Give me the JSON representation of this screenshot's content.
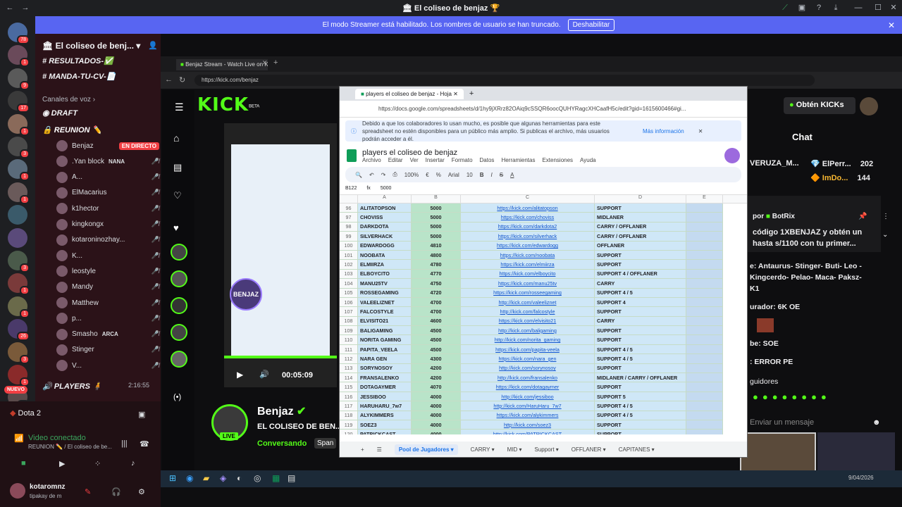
{
  "window": {
    "title": "El coliseo de benjaz"
  },
  "banner": {
    "text": "El modo Streamer está habilitado. Los nombres de usuario se han truncado.",
    "button": "Deshabilitar"
  },
  "guild_badges": [
    "78",
    "1",
    "9",
    "17",
    "1",
    "3",
    "1",
    "1",
    "",
    "",
    "3",
    "1",
    "1",
    "26",
    "3",
    "1",
    "16",
    "18",
    "3"
  ],
  "server": {
    "name": "El coliseo de benj...",
    "channels": [
      "RESULTADOS-✅",
      "MANDA-TU-CV-📄"
    ],
    "voice_category": "Canales de voz",
    "voice": [
      "DRAFT",
      "REUNION ✏️"
    ],
    "users": [
      {
        "name": "Benjaz",
        "live": "EN DIRECTO"
      },
      {
        "name": ".Yan block",
        "tag": "NANA"
      },
      {
        "name": "A..."
      },
      {
        "name": "ElMacarius"
      },
      {
        "name": "k1hector"
      },
      {
        "name": "kingkongx"
      },
      {
        "name": "kotaroninozhay..."
      },
      {
        "name": "K..."
      },
      {
        "name": "leostyle"
      },
      {
        "name": "Mandy"
      },
      {
        "name": "Matthew"
      },
      {
        "name": "p..."
      },
      {
        "name": "Smasho",
        "tag": "ARCA"
      },
      {
        "name": "Stinger"
      },
      {
        "name": "V..."
      }
    ],
    "players": "PLAYERS 🧍",
    "players_time": "2:16:55",
    "new_badge": "NUEVO"
  },
  "bottom": {
    "game": "Dota 2",
    "voice_status": "Video conectado",
    "voice_path": "REUNION ✏️ / El coliseo de be...",
    "username": "kotaromnz",
    "user_status": "tipakay de m"
  },
  "browser1": {
    "tab": "Benjaz Stream - Watch Live on Ki",
    "url": "https://kick.com/benjaz"
  },
  "kick": {
    "logo": "KICK",
    "beta": "BETA",
    "get_kicks": "Obtén KICKs",
    "chat_title": "Chat",
    "streamer": "Benjaz",
    "stream_title": "EL COLISEO DE BEN...",
    "activity": "Conversando",
    "lang": "Span",
    "live": "LIVE",
    "time": "00:05:09"
  },
  "chat": {
    "top_users": [
      {
        "name": "VERUZA_M...",
        "n": ""
      },
      {
        "name": "ElPerr...",
        "n": "202"
      },
      {
        "name": "ImDo...",
        "n": "144"
      }
    ],
    "pinned_by": "por",
    "pinned_user": "BotRix",
    "pinned_text": "código 1XBENJAZ y obtén un hasta s/1100 con tu primer...",
    "lines": [
      "e: Antaurus- Stinger- Buti- Leo -",
      "Kingcerdo- Pelao- Maca- Paksz-",
      "K1",
      "urador: 6K OE",
      "be: SOE",
      "ERROR PE"
    ],
    "followers": "guidores",
    "placeholder": "Enviar un mensaje"
  },
  "sheet": {
    "tab": "players el coliseo de benjaz - Hoja",
    "url": "https://docs.google.com/spreadsheets/d/1hy9jXRrz82OAiq9cSSQR6oocQUHYRagcXHCaafH5c/edit?gid=1615600466#gi...",
    "notice": "Debido a que los colaboradores lo usan mucho, es posible que algunas herramientas para este spreadsheet no estén disponibles para un público más amplio. Si publicas el archivo, más usuarios podrán acceder a él.",
    "notice_link": "Más información",
    "title": "players el coliseo de benjaz",
    "menu": [
      "Archivo",
      "Editar",
      "Ver",
      "Insertar",
      "Formato",
      "Datos",
      "Herramientas",
      "Extensiones",
      "Ayuda"
    ],
    "zoom": "100%",
    "font": "Arial",
    "size": "10",
    "cellref": "B122",
    "cellval": "5000",
    "cols": [
      "A",
      "B",
      "C",
      "D",
      "E"
    ],
    "rows": [
      [
        "96",
        "ALITATOPSON",
        "5000",
        "https://kick.com/alitatopson",
        "SUPPORT"
      ],
      [
        "97",
        "CHOVISS",
        "5000",
        "https://kick.com/choviss",
        "MIDLANER"
      ],
      [
        "98",
        "DARKDOTA",
        "5000",
        "https://kick.com/darkdota2",
        "CARRY / OFFLANER"
      ],
      [
        "99",
        "SILVERHACK",
        "5000",
        "https://kick.com/silverhack",
        "CARRY / OFFLANER"
      ],
      [
        "100",
        "EDWARDOGG",
        "4810",
        "https://kick.com/edwardogg",
        "OFFLANER"
      ],
      [
        "101",
        "NOOBATA",
        "4800",
        "https://kick.com/noobata",
        "SUPPORT"
      ],
      [
        "102",
        "ELMIIRZA",
        "4780",
        "https://kick.com/elmiirza",
        "SUPPORT"
      ],
      [
        "103",
        "ELBOYCITO",
        "4770",
        "https://kick.com/elboycito",
        "SUPPORT 4 / OFFLANER"
      ],
      [
        "104",
        "MANU25TV",
        "4750",
        "https://kick.com/manu25tv",
        "CARRY"
      ],
      [
        "105",
        "ROSSEGAMING",
        "4720",
        "https://kick.com/rosseegaming",
        "SUPPORT 4 / 5"
      ],
      [
        "106",
        "VALEELIZNET",
        "4700",
        "http://kick.com/valeeliznet",
        "SUPPORT 4"
      ],
      [
        "107",
        "FALCOSTYLE",
        "4700",
        "http://kick.com/falcostyle",
        "SUPPORT"
      ],
      [
        "108",
        "ELVISITO21",
        "4600",
        "https://kick.com/elvisito21",
        "CARRY"
      ],
      [
        "109",
        "BALIGAMING",
        "4500",
        "http://kick.com/baligaming",
        "SUPPORT"
      ],
      [
        "110",
        "NORITA GAMING",
        "4500",
        "http://kick.com/norita_gaming",
        "SUPPORT"
      ],
      [
        "111",
        "PAPITA_VEELA",
        "4500",
        "https://kick.com/papita-veela",
        "SUPPORT 4 / 5"
      ],
      [
        "112",
        "NARA GEN",
        "4300",
        "https://kick.com/nara_gen",
        "SUPPORT 4 / 5"
      ],
      [
        "113",
        "SORYNOSOY",
        "4200",
        "http://kick.com/sorynosoy",
        "SUPPORT"
      ],
      [
        "114",
        "FRANSALENKO",
        "4200",
        "http://kick.com/fransalenko",
        "MIDLANER / CARRY / OFFLANER"
      ],
      [
        "115",
        "DOTAGAYMER",
        "4070",
        "https://kick.com/dotagaymer",
        "SUPPORT"
      ],
      [
        "116",
        "JESSIBOO",
        "4000",
        "http://kick.com/jessiboo",
        "SUPPORT 5"
      ],
      [
        "117",
        "HARUHARU_7w7",
        "4000",
        "http://kick.com/HaruHaru_7w7",
        "SUPPORT 4 / 5"
      ],
      [
        "118",
        "ALYKIMMERS",
        "4000",
        "https://kick.com/alykimmers",
        "SUPPORT 4 / 5"
      ],
      [
        "119",
        "SOEZ3",
        "4000",
        "http://kick.com/soez3",
        "SUPPORT"
      ],
      [
        "120",
        "PATRICKCAST",
        "4000",
        "http://kick.com/PATRICKCAST",
        "SUPPORT"
      ]
    ],
    "sheet_tabs": [
      "Pool de Jugadores",
      "CARRY",
      "MID",
      "Support",
      "OFFLANER",
      "CAPITANES"
    ]
  },
  "clock": {
    "date": "9/04/2026"
  }
}
